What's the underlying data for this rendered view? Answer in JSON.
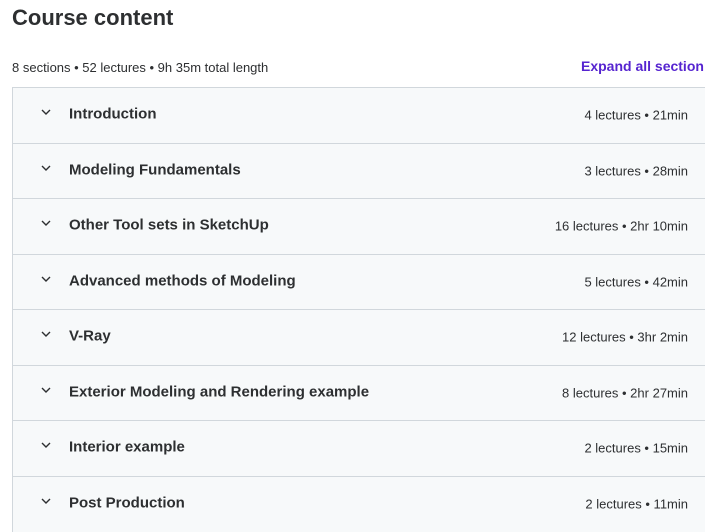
{
  "header": {
    "title": "Course content",
    "summary": "8 sections • 52 lectures • 9h 35m total length",
    "expand_all_label": "Expand all section"
  },
  "colors": {
    "link": "#5624d0",
    "row_background": "#f7f9fa",
    "border": "#d1d7dc",
    "text": "#2d2f31"
  },
  "sections": [
    {
      "title": "Introduction",
      "meta": "4 lectures • 21min",
      "icon": "chevron-down-icon"
    },
    {
      "title": "Modeling Fundamentals",
      "meta": "3 lectures • 28min",
      "icon": "chevron-down-icon"
    },
    {
      "title": "Other Tool sets in SketchUp",
      "meta": "16 lectures • 2hr 10min",
      "icon": "chevron-down-icon"
    },
    {
      "title": "Advanced methods of Modeling",
      "meta": "5 lectures • 42min",
      "icon": "chevron-down-icon"
    },
    {
      "title": "V-Ray",
      "meta": "12 lectures • 3hr 2min",
      "icon": "chevron-down-icon"
    },
    {
      "title": "Exterior Modeling and Rendering example",
      "meta": "8 lectures • 2hr 27min",
      "icon": "chevron-down-icon"
    },
    {
      "title": "Interior example",
      "meta": "2 lectures • 15min",
      "icon": "chevron-down-icon"
    },
    {
      "title": "Post Production",
      "meta": "2 lectures • 11min",
      "icon": "chevron-down-icon"
    }
  ]
}
